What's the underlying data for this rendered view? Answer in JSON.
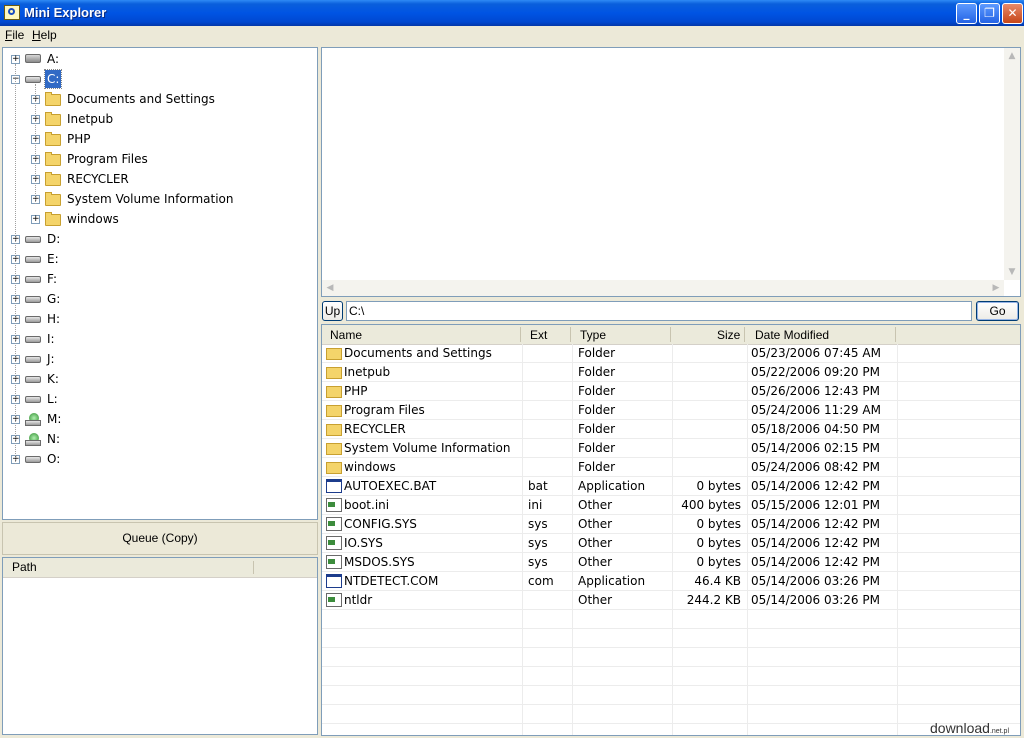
{
  "window": {
    "title": "Mini Explorer",
    "minimize": "_",
    "restore": "❐",
    "close": "✕"
  },
  "menu": [
    "File",
    "Help"
  ],
  "tree": {
    "drives": [
      {
        "label": "A:",
        "icon": "floppy-drive-icon"
      },
      {
        "label": "C:",
        "icon": "hard-drive-icon",
        "selected": true,
        "expanded": true
      },
      {
        "label": "D:",
        "icon": "hard-drive-icon"
      },
      {
        "label": "E:",
        "icon": "hard-drive-icon"
      },
      {
        "label": "F:",
        "icon": "hard-drive-icon"
      },
      {
        "label": "G:",
        "icon": "hard-drive-icon"
      },
      {
        "label": "H:",
        "icon": "hard-drive-icon"
      },
      {
        "label": "I:",
        "icon": "hard-drive-icon"
      },
      {
        "label": "J:",
        "icon": "hard-drive-icon"
      },
      {
        "label": "K:",
        "icon": "hard-drive-icon"
      },
      {
        "label": "L:",
        "icon": "hard-drive-icon"
      },
      {
        "label": "M:",
        "icon": "network-drive-icon"
      },
      {
        "label": "N:",
        "icon": "network-drive-icon"
      },
      {
        "label": "O:",
        "icon": "hard-drive-icon"
      }
    ],
    "c_children": [
      "Documents and Settings",
      "Inetpub",
      "PHP",
      "Program Files",
      "RECYCLER",
      "System Volume Information",
      "windows"
    ]
  },
  "queue_button": "Queue (Copy)",
  "path_list": {
    "header": "Path"
  },
  "address": {
    "up_label": "Up",
    "path": "C:\\",
    "go_label": "Go"
  },
  "file_list": {
    "columns": [
      "Name",
      "Ext",
      "Type",
      "Size",
      "Date Modified"
    ],
    "rows": [
      {
        "icon": "folder-icon",
        "name": "Documents and Settings",
        "ext": "",
        "type": "Folder",
        "size": "",
        "date": "05/23/2006 07:45 AM"
      },
      {
        "icon": "folder-icon",
        "name": "Inetpub",
        "ext": "",
        "type": "Folder",
        "size": "",
        "date": "05/22/2006 09:20 PM"
      },
      {
        "icon": "folder-icon",
        "name": "PHP",
        "ext": "",
        "type": "Folder",
        "size": "",
        "date": "05/26/2006 12:43 PM"
      },
      {
        "icon": "folder-icon",
        "name": "Program Files",
        "ext": "",
        "type": "Folder",
        "size": "",
        "date": "05/24/2006 11:29 AM"
      },
      {
        "icon": "folder-icon",
        "name": "RECYCLER",
        "ext": "",
        "type": "Folder",
        "size": "",
        "date": "05/18/2006 04:50 PM"
      },
      {
        "icon": "folder-icon",
        "name": "System Volume Information",
        "ext": "",
        "type": "Folder",
        "size": "",
        "date": "05/14/2006 02:15 PM"
      },
      {
        "icon": "folder-icon",
        "name": "windows",
        "ext": "",
        "type": "Folder",
        "size": "",
        "date": "05/24/2006 08:42 PM"
      },
      {
        "icon": "application-icon",
        "name": "AUTOEXEC.BAT",
        "ext": "bat",
        "type": "Application",
        "size": "0 bytes",
        "date": "05/14/2006 12:42 PM"
      },
      {
        "icon": "file-icon",
        "name": "boot.ini",
        "ext": "ini",
        "type": "Other",
        "size": "400 bytes",
        "date": "05/15/2006 12:01 PM"
      },
      {
        "icon": "file-icon",
        "name": "CONFIG.SYS",
        "ext": "sys",
        "type": "Other",
        "size": "0 bytes",
        "date": "05/14/2006 12:42 PM"
      },
      {
        "icon": "file-icon",
        "name": "IO.SYS",
        "ext": "sys",
        "type": "Other",
        "size": "0 bytes",
        "date": "05/14/2006 12:42 PM"
      },
      {
        "icon": "file-icon",
        "name": "MSDOS.SYS",
        "ext": "sys",
        "type": "Other",
        "size": "0 bytes",
        "date": "05/14/2006 12:42 PM"
      },
      {
        "icon": "application-icon",
        "name": "NTDETECT.COM",
        "ext": "com",
        "type": "Application",
        "size": "46.4 KB",
        "date": "05/14/2006 03:26 PM"
      },
      {
        "icon": "file-icon",
        "name": "ntldr",
        "ext": "",
        "type": "Other",
        "size": "244.2 KB",
        "date": "05/14/2006 03:26 PM"
      }
    ]
  },
  "watermark": {
    "text": "download",
    "suffix": ".net.pl"
  },
  "colors": {
    "selection": "#316ac5",
    "titlebar": "#0054e3",
    "border": "#7f9db9"
  }
}
